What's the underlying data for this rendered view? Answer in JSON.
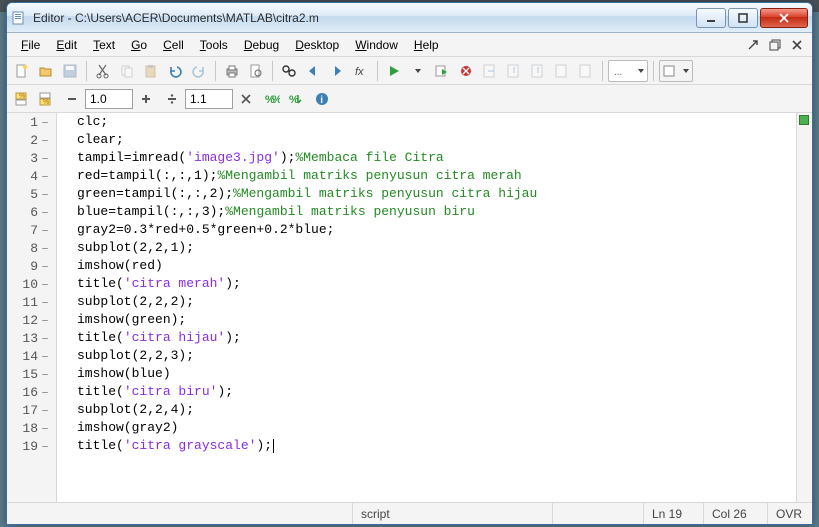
{
  "title": "Editor - C:\\Users\\ACER\\Documents\\MATLAB\\citra2.m",
  "menus": [
    "File",
    "Edit",
    "Text",
    "Go",
    "Cell",
    "Tools",
    "Debug",
    "Desktop",
    "Window",
    "Help"
  ],
  "toolbar2": {
    "zoom1": "1.0",
    "zoom2": "1.1"
  },
  "code_lines": [
    {
      "n": 1,
      "segs": [
        {
          "t": "clc;",
          "c": "k-default"
        }
      ]
    },
    {
      "n": 2,
      "segs": [
        {
          "t": "clear;",
          "c": "k-default"
        }
      ]
    },
    {
      "n": 3,
      "segs": [
        {
          "t": "tampil=imread(",
          "c": "k-default"
        },
        {
          "t": "'image3.jpg'",
          "c": "k-str"
        },
        {
          "t": ");",
          "c": "k-default"
        },
        {
          "t": "%Membaca file Citra",
          "c": "k-com"
        }
      ]
    },
    {
      "n": 4,
      "segs": [
        {
          "t": "red=tampil(:,:,1);",
          "c": "k-default"
        },
        {
          "t": "%Mengambil matriks penyusun citra merah",
          "c": "k-com"
        }
      ]
    },
    {
      "n": 5,
      "segs": [
        {
          "t": "green=tampil(:,:,2);",
          "c": "k-default"
        },
        {
          "t": "%Mengambil matriks penyusun citra hijau",
          "c": "k-com"
        }
      ]
    },
    {
      "n": 6,
      "segs": [
        {
          "t": "blue=tampil(:,:,3);",
          "c": "k-default"
        },
        {
          "t": "%Mengambil matriks penyusun biru",
          "c": "k-com"
        }
      ]
    },
    {
      "n": 7,
      "segs": [
        {
          "t": "gray2=0.3*red+0.5*green+0.2*blue;",
          "c": "k-default"
        }
      ]
    },
    {
      "n": 8,
      "segs": [
        {
          "t": "subplot(2,2,1);",
          "c": "k-default"
        }
      ]
    },
    {
      "n": 9,
      "segs": [
        {
          "t": "imshow(red)",
          "c": "k-default"
        }
      ]
    },
    {
      "n": 10,
      "segs": [
        {
          "t": "title(",
          "c": "k-default"
        },
        {
          "t": "'citra merah'",
          "c": "k-str"
        },
        {
          "t": ");",
          "c": "k-default"
        }
      ]
    },
    {
      "n": 11,
      "segs": [
        {
          "t": "subplot(2,2,2);",
          "c": "k-default"
        }
      ]
    },
    {
      "n": 12,
      "segs": [
        {
          "t": "imshow(green);",
          "c": "k-default"
        }
      ]
    },
    {
      "n": 13,
      "segs": [
        {
          "t": "title(",
          "c": "k-default"
        },
        {
          "t": "'citra hijau'",
          "c": "k-str"
        },
        {
          "t": ");",
          "c": "k-default"
        }
      ]
    },
    {
      "n": 14,
      "segs": [
        {
          "t": "subplot(2,2,3);",
          "c": "k-default"
        }
      ]
    },
    {
      "n": 15,
      "segs": [
        {
          "t": "imshow(blue)",
          "c": "k-default"
        }
      ]
    },
    {
      "n": 16,
      "segs": [
        {
          "t": "title(",
          "c": "k-default"
        },
        {
          "t": "'citra biru'",
          "c": "k-str"
        },
        {
          "t": ");",
          "c": "k-default"
        }
      ]
    },
    {
      "n": 17,
      "segs": [
        {
          "t": "subplot(2,2,4);",
          "c": "k-default"
        }
      ]
    },
    {
      "n": 18,
      "segs": [
        {
          "t": "imshow(gray2)",
          "c": "k-default"
        }
      ]
    },
    {
      "n": 19,
      "segs": [
        {
          "t": "title(",
          "c": "k-default"
        },
        {
          "t": "'citra grayscale'",
          "c": "k-str"
        },
        {
          "t": ");",
          "c": "k-default"
        }
      ],
      "cursor": true
    }
  ],
  "status": {
    "type": "script",
    "ln": "Ln  19",
    "col": "Col  26",
    "ovr": "OVR"
  }
}
